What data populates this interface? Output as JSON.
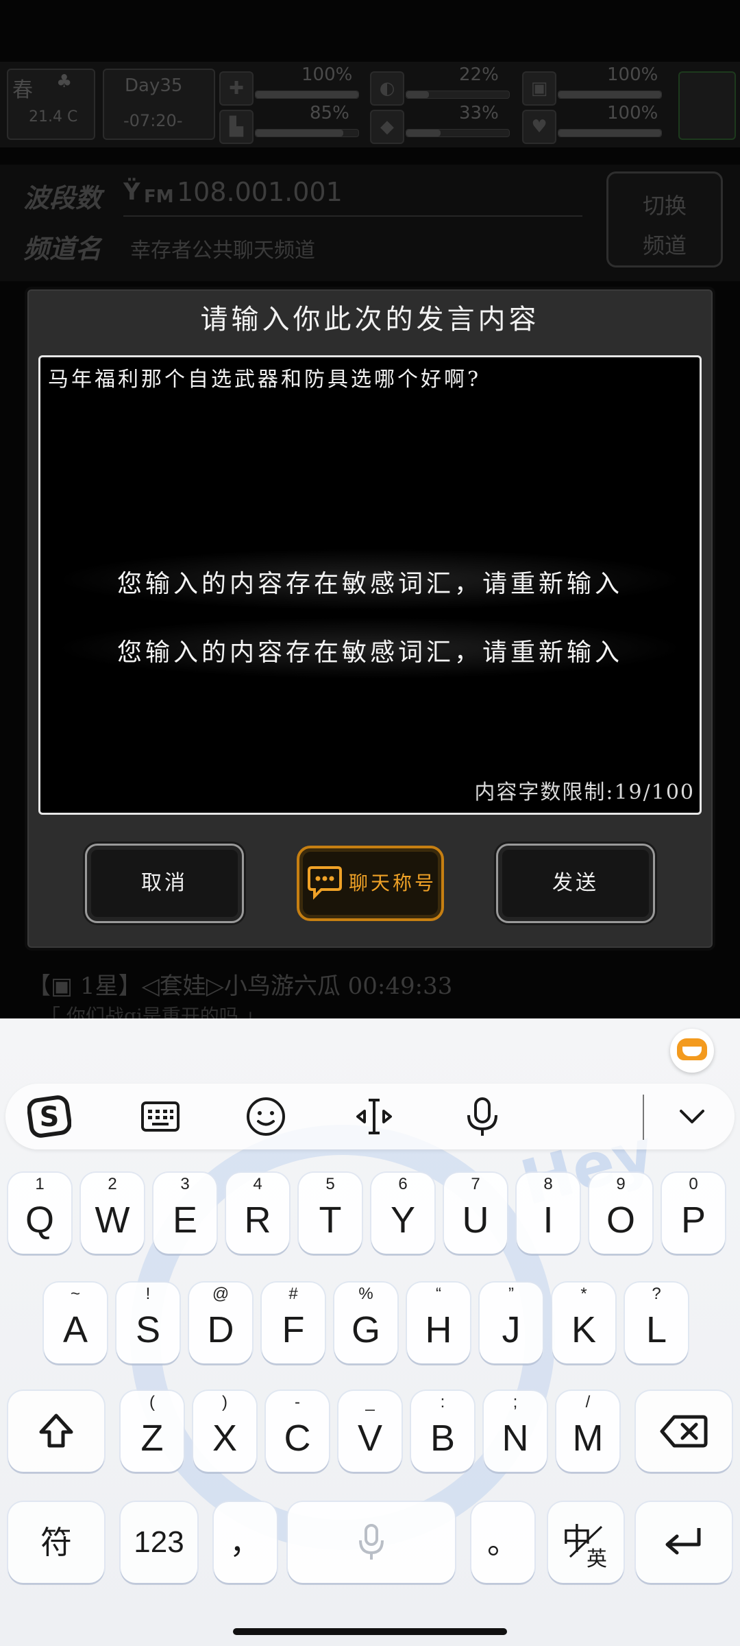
{
  "hud": {
    "season": "春",
    "temperature": "21.4 C",
    "day": "Day35",
    "time": "-07:20-",
    "stats": [
      {
        "name": "health",
        "value": "100%",
        "fill": 1.0
      },
      {
        "name": "hunger",
        "value": "22%",
        "fill": 0.22
      },
      {
        "name": "armor",
        "value": "100%",
        "fill": 1.0
      },
      {
        "name": "stamina",
        "value": "85%",
        "fill": 0.85
      },
      {
        "name": "thirst",
        "value": "33%",
        "fill": 0.33
      },
      {
        "name": "mood",
        "value": "100%",
        "fill": 1.0
      }
    ]
  },
  "radio": {
    "band_label": "波段数",
    "frequency": "108.001.001",
    "fm_label": "FM",
    "channel_label": "频道名",
    "channel_name": "幸存者公共聊天频道",
    "switch_label_1": "切换",
    "switch_label_2": "频道"
  },
  "dialog": {
    "title": "请输入你此次的发言内容",
    "input_value": "马年福利那个自选武器和防具选哪个好啊?",
    "toast_1": "您输入的内容存在敏感词汇，请重新输入",
    "toast_2": "您输入的内容存在敏感词汇，请重新输入",
    "char_limit": "内容字数限制:19/100",
    "cancel_label": "取消",
    "chat_title_label": "聊天称号",
    "send_label": "发送"
  },
  "chatlog": {
    "line1": "【▣ 1星】◁套娃▷小鸟游六瓜  00:49:33",
    "line2": "「 你们战gi是重开的吗 」"
  },
  "keyboard": {
    "row1": [
      {
        "main": "Q",
        "sub": "1"
      },
      {
        "main": "W",
        "sub": "2"
      },
      {
        "main": "E",
        "sub": "3"
      },
      {
        "main": "R",
        "sub": "4"
      },
      {
        "main": "T",
        "sub": "5"
      },
      {
        "main": "Y",
        "sub": "6"
      },
      {
        "main": "U",
        "sub": "7"
      },
      {
        "main": "I",
        "sub": "8"
      },
      {
        "main": "O",
        "sub": "9"
      },
      {
        "main": "P",
        "sub": "0"
      }
    ],
    "row2": [
      {
        "main": "A",
        "sub": "~"
      },
      {
        "main": "S",
        "sub": "!"
      },
      {
        "main": "D",
        "sub": "@"
      },
      {
        "main": "F",
        "sub": "#"
      },
      {
        "main": "G",
        "sub": "%"
      },
      {
        "main": "H",
        "sub": "“"
      },
      {
        "main": "J",
        "sub": "”"
      },
      {
        "main": "K",
        "sub": "*"
      },
      {
        "main": "L",
        "sub": "?"
      }
    ],
    "row3": [
      {
        "main": "Z",
        "sub": "("
      },
      {
        "main": "X",
        "sub": ")"
      },
      {
        "main": "C",
        "sub": "-"
      },
      {
        "main": "V",
        "sub": "_"
      },
      {
        "main": "B",
        "sub": ":"
      },
      {
        "main": "N",
        "sub": ";"
      },
      {
        "main": "M",
        "sub": "/"
      }
    ],
    "symbol_label": "符",
    "numbers_label": "123",
    "comma_label": "，",
    "period_label": "。",
    "lang_main": "中",
    "lang_sub": "英"
  }
}
